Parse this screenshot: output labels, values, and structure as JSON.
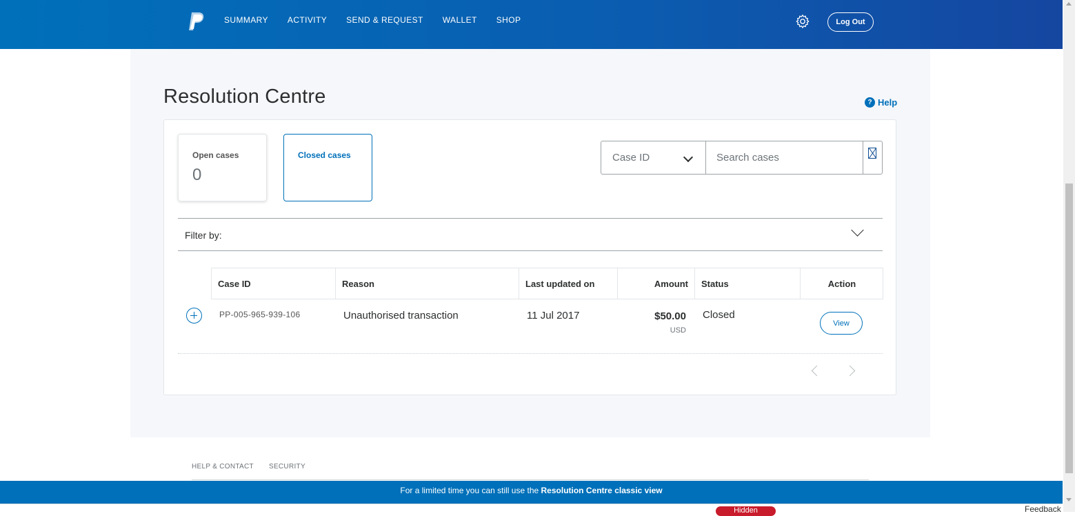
{
  "nav": {
    "items": [
      {
        "label": "SUMMARY"
      },
      {
        "label": "ACTIVITY"
      },
      {
        "label": "SEND & REQUEST"
      },
      {
        "label": "WALLET"
      },
      {
        "label": "SHOP"
      }
    ],
    "logout_label": "Log Out",
    "settings_icon": "gear-icon",
    "logo_icon": "paypal-logo"
  },
  "page": {
    "title": "Resolution Centre",
    "help_label": "Help",
    "help_icon": "question-icon"
  },
  "cases_tiles": {
    "open": {
      "label": "Open cases",
      "count": "0"
    },
    "closed": {
      "label": "Closed cases"
    }
  },
  "search": {
    "field_selected": "Case ID",
    "placeholder": "Search cases",
    "button_icon": "search-icon"
  },
  "filter": {
    "label": "Filter by:"
  },
  "table": {
    "columns": [
      "Case ID",
      "Reason",
      "Last updated on",
      "Amount",
      "Status",
      "Action"
    ],
    "rows": [
      {
        "case_id": "PP-005-965-939-106",
        "reason": "Unauthorised transaction",
        "last_updated": "11 Jul 2017",
        "amount": "$50.00",
        "currency": "USD",
        "status": "Closed",
        "action_label": "View"
      }
    ]
  },
  "footer": {
    "links": [
      "HELP & CONTACT",
      "SECURITY"
    ],
    "banner_text": "For a limited time you can still use the ",
    "banner_link": "Resolution Centre classic view",
    "hidden_label": "Hidden",
    "feedback_label": "Feedback"
  },
  "colors": {
    "brand_blue": "#0070ba",
    "nav_dark_blue": "#1546a0",
    "page_bg": "#f5f7fa"
  }
}
